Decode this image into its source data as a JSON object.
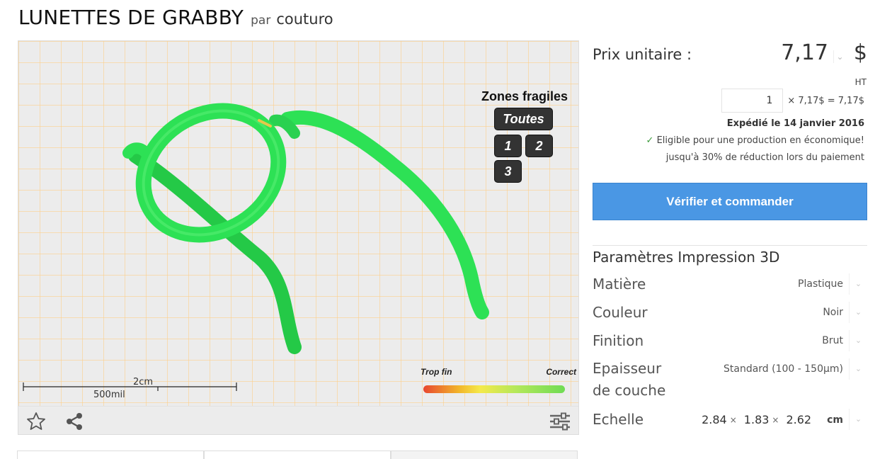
{
  "product": {
    "title": "LUNETTES DE GRABBY",
    "by": "par",
    "author": "couturo"
  },
  "viewer": {
    "zones": {
      "title": "Zones fragiles",
      "all_label": "Toutes",
      "zone_labels": [
        "1",
        "2",
        "3"
      ]
    },
    "scale_bar": {
      "top_label": "2cm",
      "bottom_label": "500mil"
    },
    "thickness_legend": {
      "low_label": "Trop fin",
      "high_label": "Correct"
    },
    "model_color": "#2de155",
    "toolbar": {
      "favorite_icon": "star-icon",
      "share_icon": "share-icon",
      "settings_icon": "sliders-icon"
    }
  },
  "pricing": {
    "label": "Prix unitaire :",
    "value": "7,17",
    "currency": "$",
    "tax_note": "HT",
    "quantity": "1",
    "formula": "× 7,17$ = 7,17$",
    "shipping": "Expédié le 14 janvier 2016",
    "eligible_check": "✓",
    "eligible_text": "Eligible pour une production en économique!",
    "discount_text": "jusqu'à 30% de réduction lors du paiement",
    "order_button": "Vérifier et commander",
    "accent_color": "#4a97e4"
  },
  "params": {
    "title": "Paramètres Impression 3D",
    "material": {
      "label": "Matière",
      "value": "Plastique"
    },
    "color": {
      "label": "Couleur",
      "value": "Noir"
    },
    "finish": {
      "label": "Finition",
      "value": "Brut"
    },
    "layer": {
      "label_line1": "Epaisseur",
      "label_line2": "de couche",
      "value": "Standard (100 - 150µm)"
    },
    "scale": {
      "label": "Echelle",
      "x": "2.84",
      "y": "1.83",
      "z": "2.62",
      "times": "×",
      "unit": "cm"
    }
  }
}
